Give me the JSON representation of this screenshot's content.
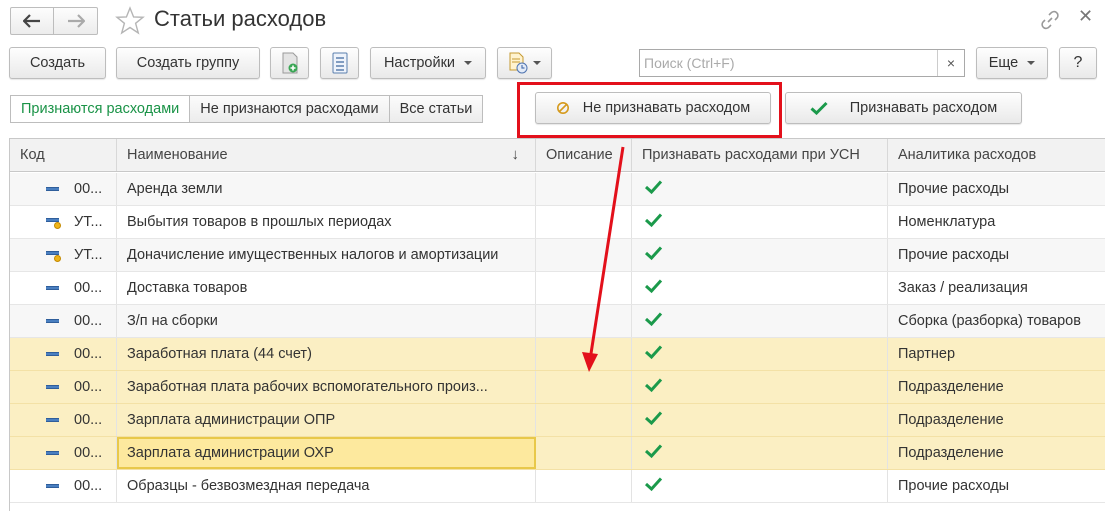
{
  "window": {
    "title": "Статьи расходов"
  },
  "toolbar": {
    "create": "Создать",
    "create_group": "Создать группу",
    "settings": "Настройки",
    "search_placeholder": "Поиск (Ctrl+F)",
    "search_clear": "×",
    "more": "Еще",
    "help": "?"
  },
  "filter_tabs": [
    {
      "label": "Признаются расходами",
      "active": true
    },
    {
      "label": "Не признаются расходами",
      "active": false
    },
    {
      "label": "Все статьи",
      "active": false
    }
  ],
  "actions": {
    "do_not_recognize": "Не признавать расходом",
    "recognize": "Признавать расходом"
  },
  "columns": {
    "code": "Код",
    "name": "Наименование",
    "sort_indicator": "↓",
    "description": "Описание",
    "recognize_usn": "Признавать расходами при УСН",
    "analytics": "Аналитика расходов"
  },
  "rows": [
    {
      "code": "00...",
      "name": "Аренда земли",
      "description": "",
      "recognized": true,
      "analytics": "Прочие расходы",
      "icon": "item-icon",
      "highlighted": false,
      "selected": false
    },
    {
      "code": "УТ...",
      "name": "Выбытия товаров в прошлых периодах",
      "description": "",
      "recognized": true,
      "analytics": "Номенклатура",
      "icon": "item-predefined-icon",
      "highlighted": false,
      "selected": false
    },
    {
      "code": "УТ...",
      "name": "Доначисление имущественных налогов и амортизации",
      "description": "",
      "recognized": true,
      "analytics": "Прочие расходы",
      "icon": "item-predefined-icon",
      "highlighted": false,
      "selected": false
    },
    {
      "code": "00...",
      "name": "Доставка товаров",
      "description": "",
      "recognized": true,
      "analytics": "Заказ / реализация",
      "icon": "item-icon",
      "highlighted": false,
      "selected": false
    },
    {
      "code": "00...",
      "name": "З/п на сборки",
      "description": "",
      "recognized": true,
      "analytics": "Сборка (разборка) товаров",
      "icon": "item-icon",
      "highlighted": false,
      "selected": false
    },
    {
      "code": "00...",
      "name": "Заработная плата (44 счет)",
      "description": "",
      "recognized": true,
      "analytics": "Партнер",
      "icon": "item-icon",
      "highlighted": true,
      "selected": false
    },
    {
      "code": "00...",
      "name": "Заработная плата рабочих вспомогательного произ...",
      "description": "",
      "recognized": true,
      "analytics": "Подразделение",
      "icon": "item-icon",
      "highlighted": true,
      "selected": false
    },
    {
      "code": "00...",
      "name": "Зарплата администрации ОПР",
      "description": "",
      "recognized": true,
      "analytics": "Подразделение",
      "icon": "item-icon",
      "highlighted": true,
      "selected": false
    },
    {
      "code": "00...",
      "name": "Зарплата администрации ОХР",
      "description": "",
      "recognized": true,
      "analytics": "Подразделение",
      "icon": "item-icon",
      "highlighted": true,
      "selected": true
    },
    {
      "code": "00...",
      "name": "Образцы - безвозмездная передача",
      "description": "",
      "recognized": true,
      "analytics": "Прочие расходы",
      "icon": "item-icon",
      "highlighted": false,
      "selected": false
    }
  ],
  "colors": {
    "accent_green": "#1a9347",
    "check_green": "#1b9a4b",
    "highlight_row": "#fbefc3",
    "selected_cell": "#fde99e",
    "annotation_red": "#e3101b"
  }
}
